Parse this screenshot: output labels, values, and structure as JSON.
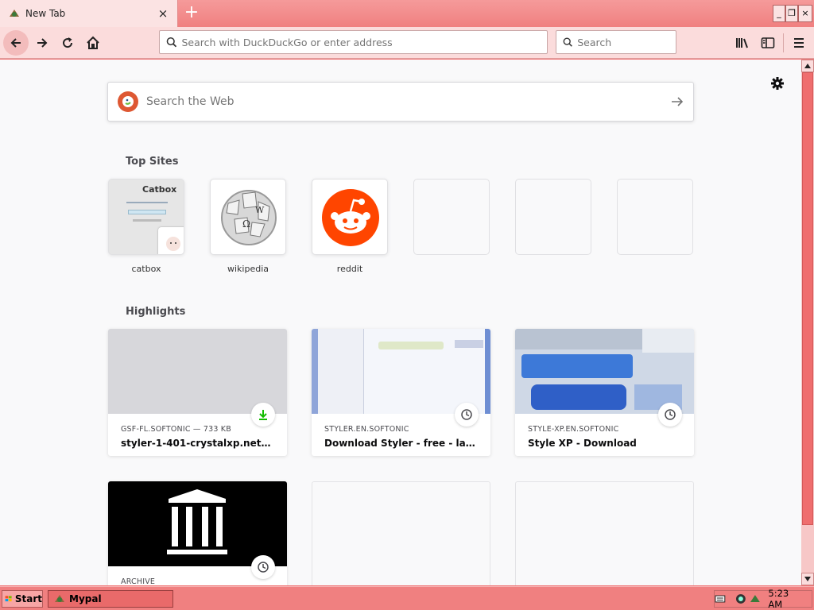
{
  "tab": {
    "title": "New Tab",
    "close_glyph": "×",
    "favicon": "mypal-icon"
  },
  "new_tab_glyph": "+",
  "window_controls": {
    "minimize": "_",
    "restore": "❐",
    "close": "×"
  },
  "toolbar": {
    "url_placeholder": "Search with DuckDuckGo or enter address",
    "search_placeholder": "Search"
  },
  "newtab": {
    "web_search_placeholder": "Search the Web",
    "top_sites_title": "Top Sites",
    "highlights_title": "Highlights",
    "top_sites": [
      {
        "label": "catbox"
      },
      {
        "label": "wikipedia"
      },
      {
        "label": "reddit"
      },
      {
        "label": ""
      },
      {
        "label": ""
      },
      {
        "label": ""
      }
    ],
    "highlights": [
      {
        "host": "GSF-FL.SOFTONIC — 733 KB",
        "title": "styler-1-401-crystalxp.net-en-5...",
        "badge": "download-icon"
      },
      {
        "host": "STYLER.EN.SOFTONIC",
        "title": "Download Styler - free - latest v...",
        "badge": "clock-icon"
      },
      {
        "host": "STYLE-XP.EN.SOFTONIC",
        "title": "Style XP - Download",
        "badge": "clock-icon"
      },
      {
        "host": "ARCHIVE",
        "title": "",
        "badge": "clock-icon"
      }
    ],
    "catbox_thumb_text": "Catbox"
  },
  "taskbar": {
    "start_label": "Start",
    "task_label": "Mypal",
    "clock": "5:23 AM"
  },
  "colors": {
    "theme": "#f08080",
    "toolbar": "#fbdcdc",
    "reddit": "#ff4500",
    "download_green": "#12bc00"
  }
}
